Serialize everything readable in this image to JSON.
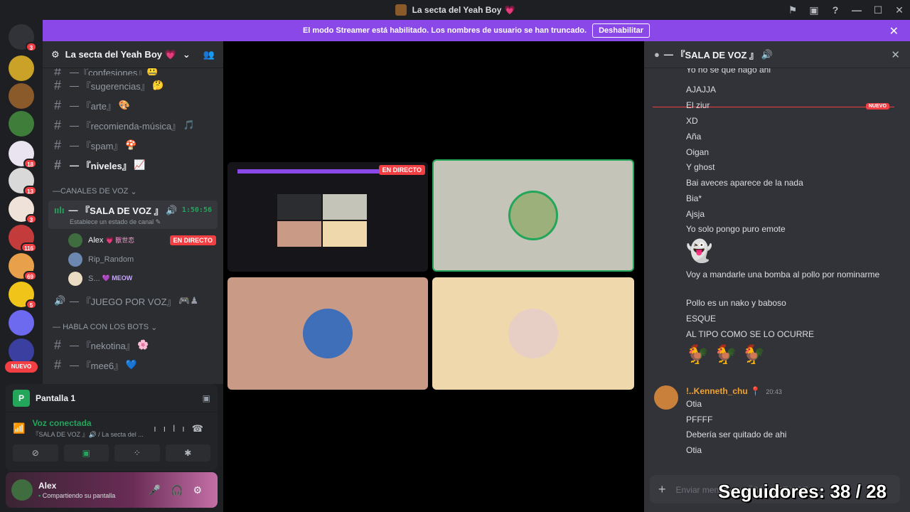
{
  "window": {
    "title": "La secta del Yeah Boy",
    "title_emoji": "💗"
  },
  "streamer_bar": {
    "message": "El modo Streamer está habilitado. Los nombres de usuario se han truncado.",
    "disable_label": "Deshabilitar"
  },
  "server_rail": {
    "badges": [
      "3",
      "18",
      "13",
      "3",
      "116",
      "69",
      "5"
    ],
    "new_label": "NUEVO"
  },
  "server": {
    "name": "La secta del Yeah Boy",
    "emoji": "💗"
  },
  "channels": [
    {
      "name": "『confesiones』",
      "emoji": "🤐",
      "bold": false
    },
    {
      "name": "『sugerencias』",
      "emoji": "🤔",
      "bold": false
    },
    {
      "name": "『arte』",
      "emoji": "🎨",
      "bold": false
    },
    {
      "name": "『recomienda-música』",
      "emoji": "🎵",
      "bold": false
    },
    {
      "name": "『spam』",
      "emoji": "🍄",
      "bold": false
    },
    {
      "name": "『niveles』",
      "emoji": "📈",
      "bold": true
    }
  ],
  "voice_category": "CANALES DE VOZ",
  "voice_channel": {
    "name": "『SALA DE VOZ 』",
    "timer": "1:50:56",
    "status_placeholder": "Establece un estado de canal"
  },
  "voice_users": [
    {
      "name": "Alex",
      "tag": "💗 獣世恋",
      "live": "EN DIRECTO"
    },
    {
      "name": "Rip_Random",
      "tag": "",
      "live": ""
    },
    {
      "name": "S...",
      "tag": "💜 MEOW",
      "live": ""
    }
  ],
  "voice_channel_2": {
    "name": "『JUEGO POR VOZ』",
    "emoji": "🎮♟"
  },
  "bots_category": "HABLA CON LOS BOTS",
  "bot_channels": [
    {
      "name": "『nekotina』",
      "emoji": "🌸"
    },
    {
      "name": "『mee6』",
      "emoji": "💙"
    }
  ],
  "screen_share": {
    "label": "Pantalla 1",
    "icon_letter": "P"
  },
  "voice_connected": {
    "title": "Voz conectada",
    "subtitle": "『SALA DE VOZ 』🔊 / La secta del ..."
  },
  "user": {
    "name": "Alex",
    "status": "Compartiendo su pantalla"
  },
  "stage": {
    "live_label": "EN DIRECTO",
    "tile_colors": [
      "#16161a",
      "#c4c5b8",
      "#c99b87",
      "#efd9ac"
    ]
  },
  "chat": {
    "title": "『SALA DE VOZ 』",
    "new_label": "NUEVO",
    "top_line": "Yo no se que hago ahi",
    "messages": [
      "AJAJJA",
      "El ziur",
      "XD",
      "Aña",
      "Oigan",
      "Y ghost",
      "Bai aveces aparece de la nada",
      "Bia*",
      "Ajsja",
      "Yo solo pongo puro emote",
      "👻",
      "Voy a mandarle una bomba al pollo por nominarme",
      "Pollo es un nako y baboso",
      "ESQUE",
      "AL TIPO COMO SE LO OCURRE",
      "🐓 🐓 🐓"
    ],
    "second_author": {
      "name": "!..Kenneth_chu",
      "time": "20:43"
    },
    "second_messages": [
      "Otia",
      "PFFFF",
      "Debería ser quitado de ahi",
      "Otia"
    ],
    "input_placeholder": "Enviar mensaje a 『SALA DE VOZ 』"
  },
  "overlay": {
    "followers": "Seguidores: 38 / 28"
  }
}
